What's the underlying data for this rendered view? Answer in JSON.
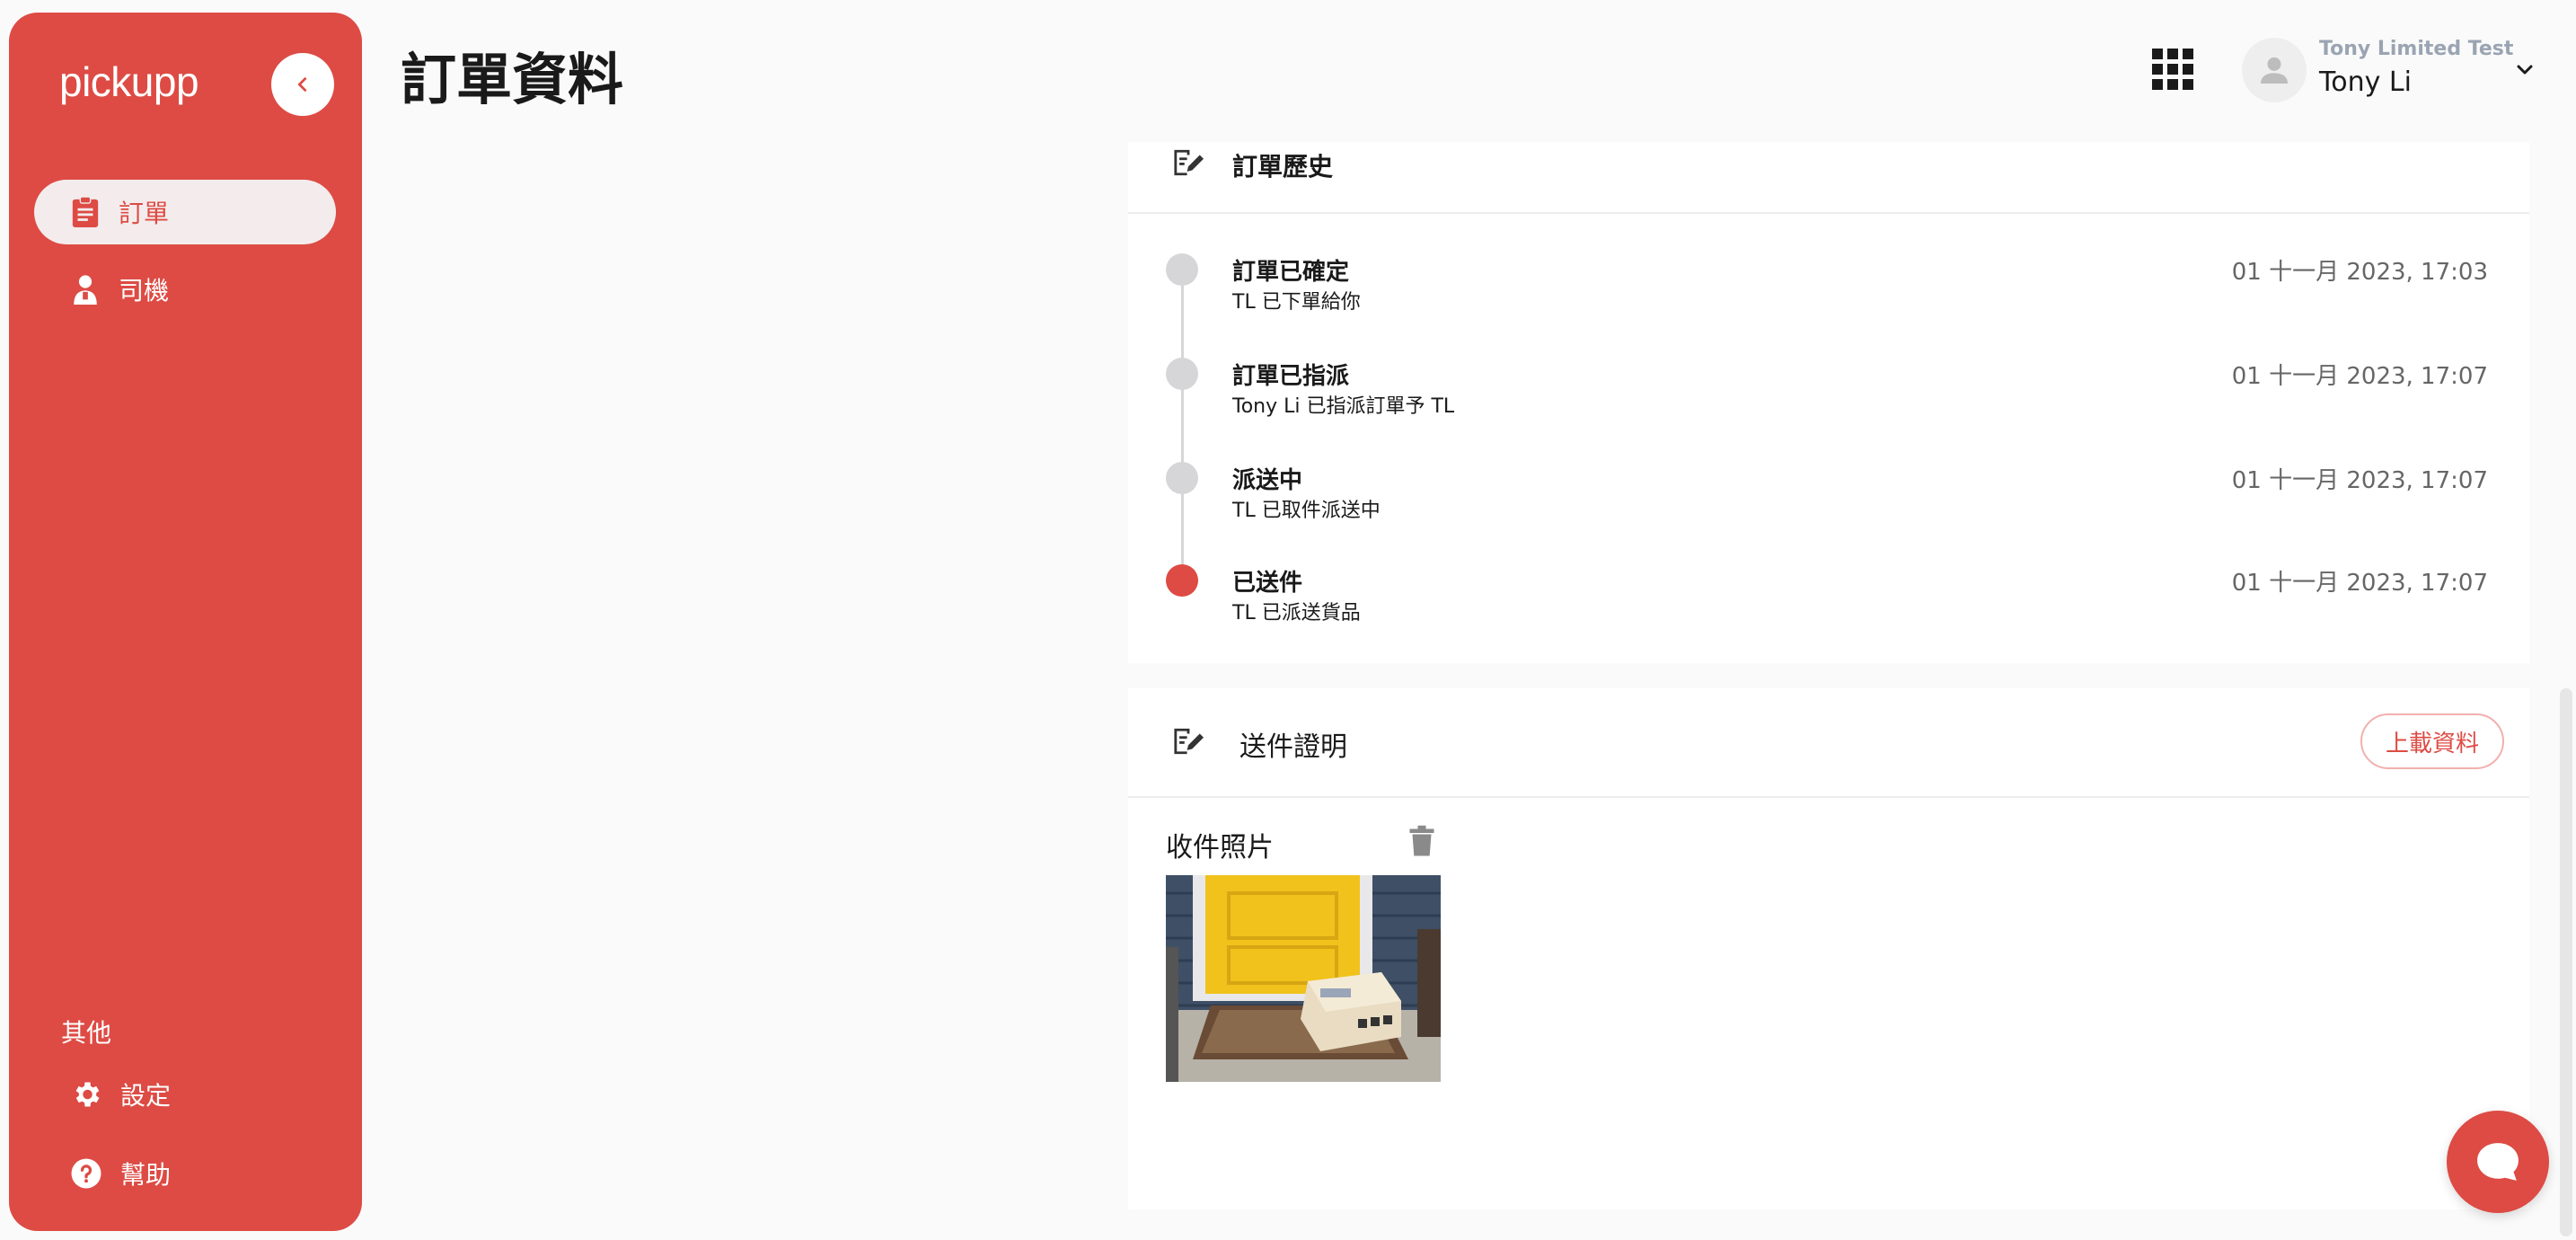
{
  "sidebar": {
    "logo": "pickupp",
    "nav": [
      {
        "label": "訂單",
        "active": true
      },
      {
        "label": "司機",
        "active": false
      }
    ],
    "other_heading": "其他",
    "bottom_nav": [
      {
        "label": "設定"
      },
      {
        "label": "幫助"
      }
    ]
  },
  "header": {
    "title": "訂單資料",
    "company": "Tony Limited Test",
    "user_name": "Tony Li"
  },
  "history": {
    "title": "訂單歷史",
    "events": [
      {
        "title": "訂單已確定",
        "desc": "TL 已下單給你",
        "time": "01 十一月 2023, 17:03",
        "current": false
      },
      {
        "title": "訂單已指派",
        "desc": "Tony Li 已指派訂單予 TL",
        "time": "01 十一月 2023, 17:07",
        "current": false
      },
      {
        "title": "派送中",
        "desc": "TL 已取件派送中",
        "time": "01 十一月 2023, 17:07",
        "current": false
      },
      {
        "title": "已送件",
        "desc": "TL 已派送貨品",
        "time": "01 十一月 2023, 17:07",
        "current": true
      }
    ]
  },
  "proof_of_delivery": {
    "title": "送件證明",
    "upload_label": "上載資料",
    "photo_label": "收件照片"
  },
  "colors": {
    "brand": "#dd4b44",
    "timeline_inactive": "#d6d6d9"
  }
}
